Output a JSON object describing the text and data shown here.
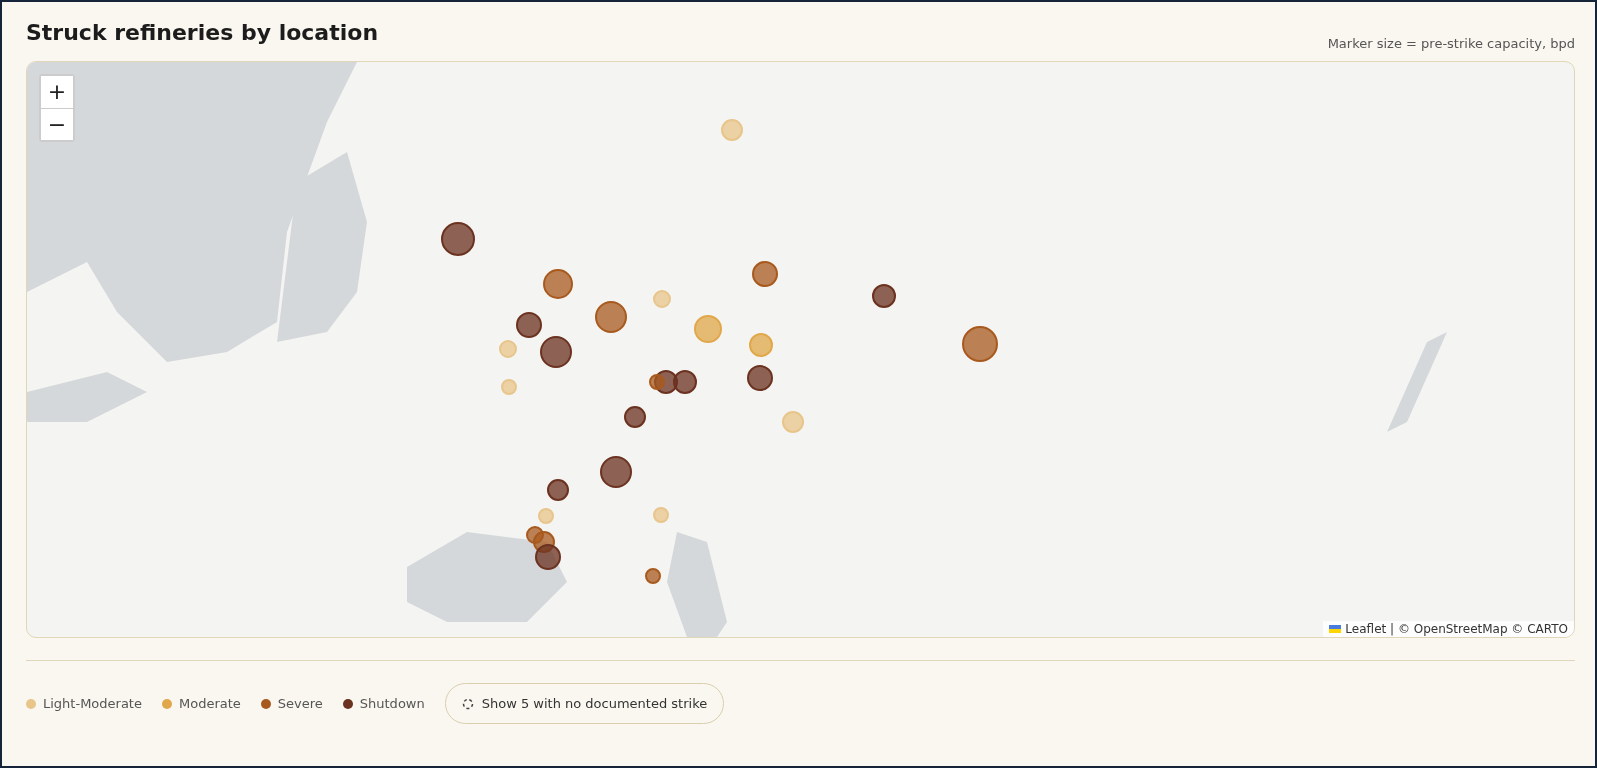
{
  "title": "Struck refineries by location",
  "note": "Marker size = pre-strike capacity, bpd",
  "map": {
    "zoom_in": "+",
    "zoom_out": "−",
    "attribution": "Leaflet | © OpenStreetMap © CARTO"
  },
  "legend": [
    {
      "label": "Light-Moderate",
      "color": "#e8c58a"
    },
    {
      "label": "Moderate",
      "color": "#e0a84a"
    },
    {
      "label": "Severe",
      "color": "#a85a1e"
    },
    {
      "label": "Shutdown",
      "color": "#6b3220"
    }
  ],
  "toggle_button": "Show 5 with no documented strike"
}
